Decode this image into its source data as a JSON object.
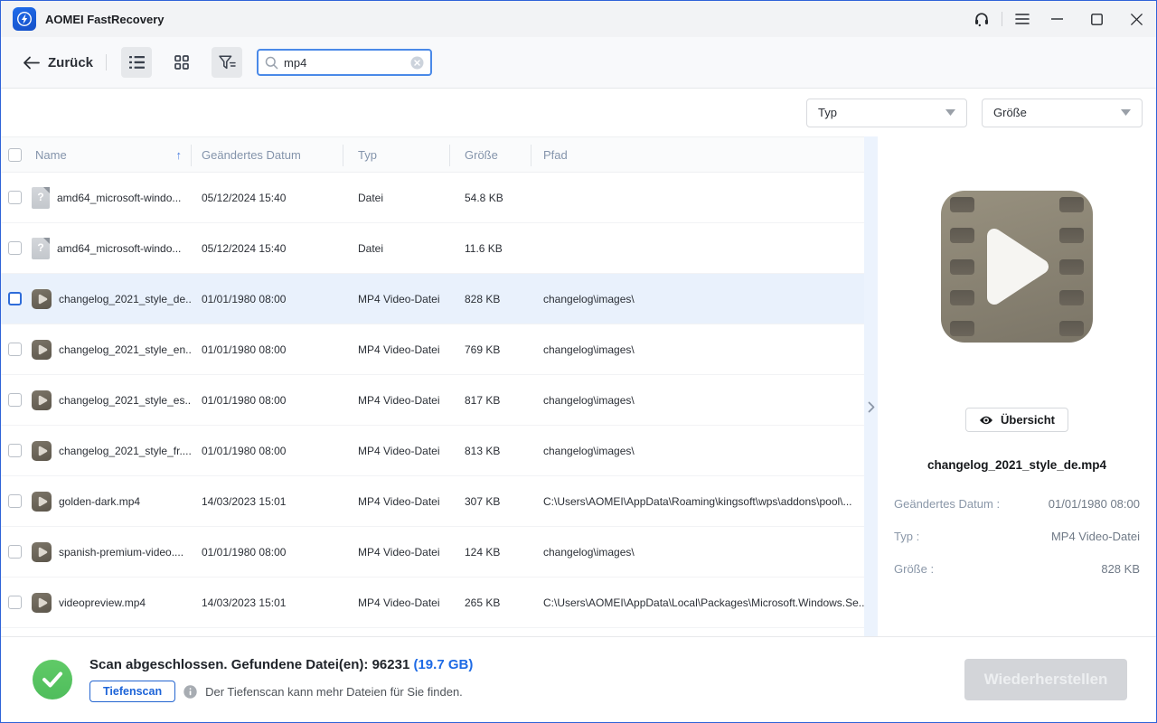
{
  "window": {
    "title": "AOMEI FastRecovery"
  },
  "toolbar": {
    "back_label": "Zurück",
    "search": {
      "value": "mp4"
    }
  },
  "filters": {
    "type_label": "Typ",
    "size_label": "Größe"
  },
  "table": {
    "columns": [
      "Name",
      "Geändertes Datum",
      "Typ",
      "Größe",
      "Pfad"
    ],
    "sort_column": "Name",
    "sort_direction": "up",
    "rows": [
      {
        "name": "amd64_microsoft-windo...",
        "date": "05/12/2024 15:40",
        "type": "Datei",
        "size": "54.8 KB",
        "path": "",
        "icon": "unknown",
        "selected": false
      },
      {
        "name": "amd64_microsoft-windo...",
        "date": "05/12/2024 15:40",
        "type": "Datei",
        "size": "11.6 KB",
        "path": "",
        "icon": "unknown",
        "selected": false
      },
      {
        "name": "changelog_2021_style_de....",
        "date": "01/01/1980 08:00",
        "type": "MP4 Video-Datei",
        "size": "828 KB",
        "path": "changelog\\images\\",
        "icon": "video",
        "selected": true
      },
      {
        "name": "changelog_2021_style_en....",
        "date": "01/01/1980 08:00",
        "type": "MP4 Video-Datei",
        "size": "769 KB",
        "path": "changelog\\images\\",
        "icon": "video",
        "selected": false
      },
      {
        "name": "changelog_2021_style_es....",
        "date": "01/01/1980 08:00",
        "type": "MP4 Video-Datei",
        "size": "817 KB",
        "path": "changelog\\images\\",
        "icon": "video",
        "selected": false
      },
      {
        "name": "changelog_2021_style_fr....",
        "date": "01/01/1980 08:00",
        "type": "MP4 Video-Datei",
        "size": "813 KB",
        "path": "changelog\\images\\",
        "icon": "video",
        "selected": false
      },
      {
        "name": "golden-dark.mp4",
        "date": "14/03/2023 15:01",
        "type": "MP4 Video-Datei",
        "size": "307 KB",
        "path": "C:\\Users\\AOMEI\\AppData\\Roaming\\kingsoft\\wps\\addons\\pool\\...",
        "icon": "video",
        "selected": false
      },
      {
        "name": "spanish-premium-video....",
        "date": "01/01/1980 08:00",
        "type": "MP4 Video-Datei",
        "size": "124 KB",
        "path": "changelog\\images\\",
        "icon": "video",
        "selected": false
      },
      {
        "name": "videopreview.mp4",
        "date": "14/03/2023 15:01",
        "type": "MP4 Video-Datei",
        "size": "265 KB",
        "path": "C:\\Users\\AOMEI\\AppData\\Local\\Packages\\Microsoft.Windows.Se...",
        "icon": "video",
        "selected": false
      }
    ]
  },
  "preview": {
    "overview_label": "Übersicht",
    "filename": "changelog_2021_style_de.mp4",
    "details": [
      {
        "label": "Geändertes Datum :",
        "value": "01/01/1980 08:00"
      },
      {
        "label": "Typ :",
        "value": "MP4 Video-Datei"
      },
      {
        "label": "Größe :",
        "value": "828 KB"
      }
    ]
  },
  "statusbar": {
    "scan_text": "Scan abgeschlossen. Gefundene Datei(en): 96231",
    "scan_size": "(19.7 GB)",
    "deep_scan_label": "Tiefenscan",
    "deep_scan_hint": "Der Tiefenscan kann mehr Dateien für Sie finden.",
    "recover_label": "Wiederherstellen"
  },
  "colors": {
    "accent_blue": "#1d64d8",
    "window_border": "#2f63d8",
    "selected_row": "#e9f1fc",
    "success_green": "#55c25f",
    "disabled_button": "#d3d5d9"
  }
}
